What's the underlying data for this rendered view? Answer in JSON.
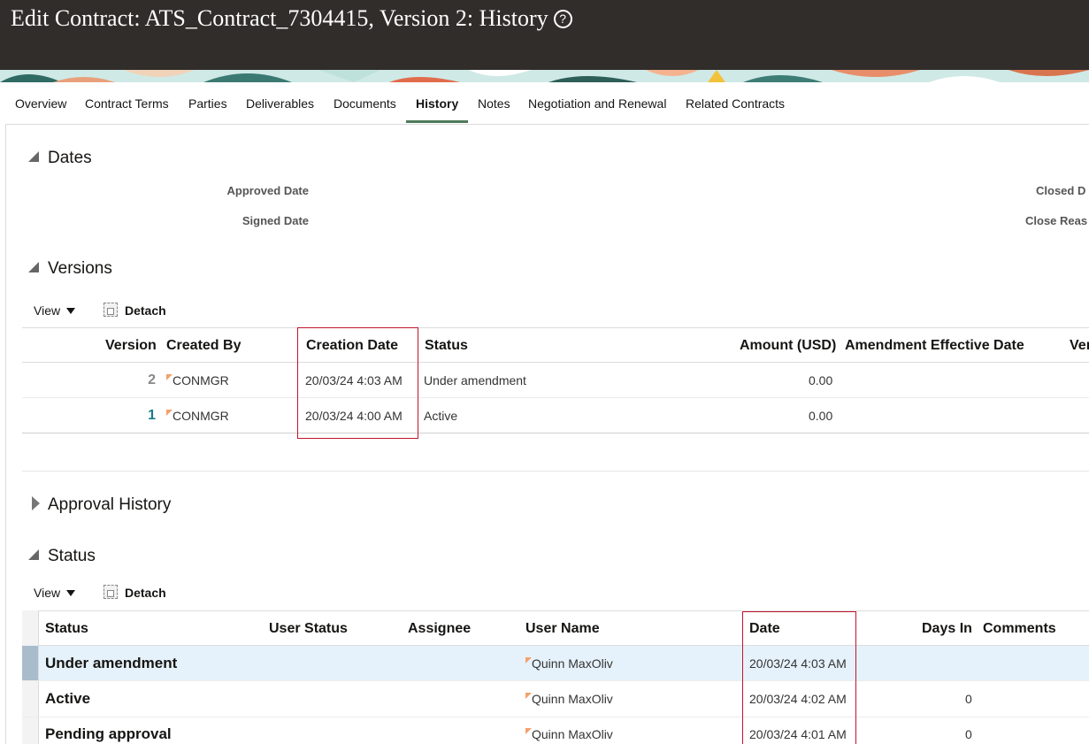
{
  "header": {
    "title": "Edit Contract: ATS_Contract_7304415, Version 2: History",
    "help_icon": "?"
  },
  "tabs": [
    {
      "label": "Overview"
    },
    {
      "label": "Contract Terms"
    },
    {
      "label": "Parties"
    },
    {
      "label": "Deliverables"
    },
    {
      "label": "Documents"
    },
    {
      "label": "History",
      "active": true
    },
    {
      "label": "Notes"
    },
    {
      "label": "Negotiation and Renewal"
    },
    {
      "label": "Related Contracts"
    }
  ],
  "dates": {
    "title": "Dates",
    "approved_label": "Approved Date",
    "signed_label": "Signed Date",
    "closed_label": "Closed D",
    "close_reason_label": "Close Reas"
  },
  "versions": {
    "title": "Versions",
    "view_label": "View",
    "detach_label": "Detach",
    "columns": [
      "Version",
      "Created By",
      "Creation Date",
      "Status",
      "Amount (USD)",
      "Amendment Effective Date",
      "Ver"
    ],
    "rows": [
      {
        "version": "2",
        "created_by": "CONMGR",
        "creation_date": "20/03/24 4:03 AM",
        "status": "Under amendment",
        "amount": "0.00"
      },
      {
        "version": "1",
        "created_by": "CONMGR",
        "creation_date": "20/03/24 4:00 AM",
        "status": "Active",
        "amount": "0.00"
      }
    ]
  },
  "approval": {
    "title": "Approval History"
  },
  "status": {
    "title": "Status",
    "view_label": "View",
    "detach_label": "Detach",
    "columns": [
      "Status",
      "User Status",
      "Assignee",
      "User Name",
      "Date",
      "Days In",
      "Comments"
    ],
    "rows": [
      {
        "status": "Under amendment",
        "user_name": "Quinn MaxOliv",
        "date": "20/03/24 4:03 AM",
        "days_in": ""
      },
      {
        "status": "Active",
        "user_name": "Quinn MaxOliv",
        "date": "20/03/24 4:02 AM",
        "days_in": "0"
      },
      {
        "status": "Pending approval",
        "user_name": "Quinn MaxOliv",
        "date": "20/03/24 4:01 AM",
        "days_in": "0"
      }
    ]
  },
  "colors": {
    "header_bg": "#312d2a",
    "tab_underline": "#4e7a5a",
    "highlight_box": "#c0142b",
    "selected_row": "#e6f2fb",
    "flag": "#f4a06b"
  }
}
